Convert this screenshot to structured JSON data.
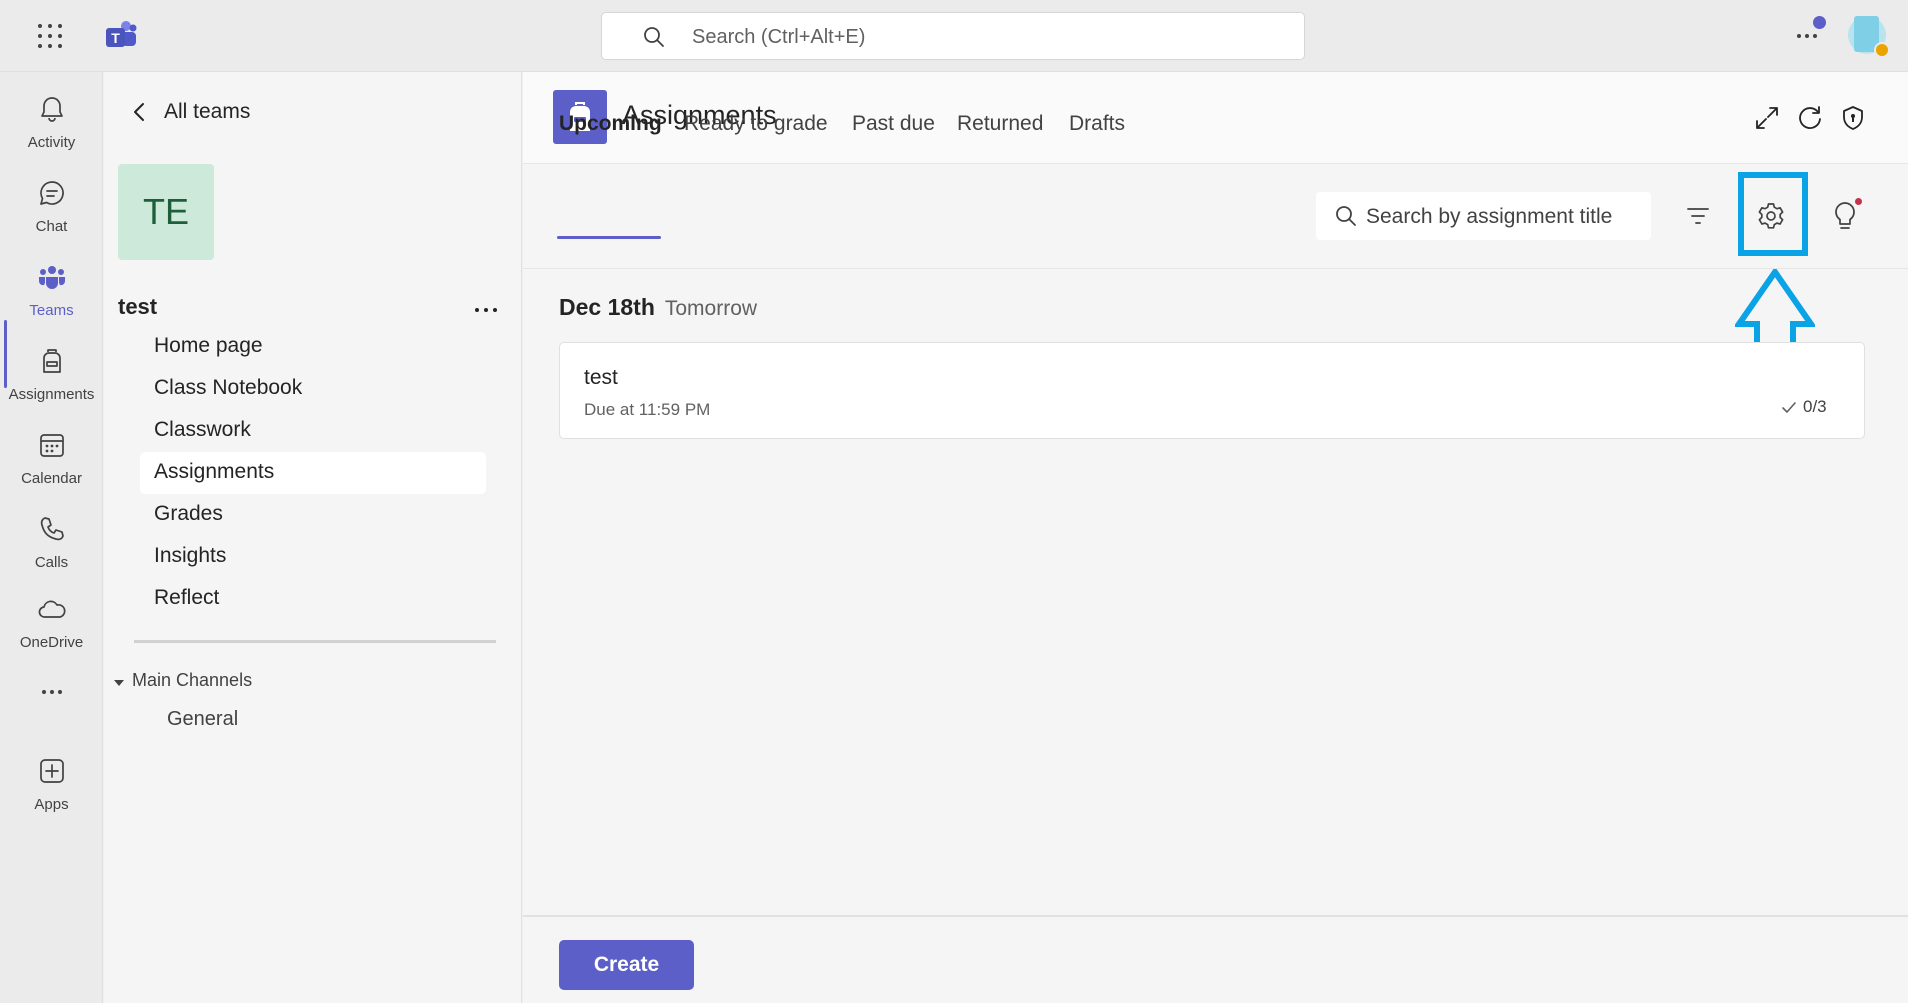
{
  "topbar": {
    "search_placeholder": "Search (Ctrl+Alt+E)",
    "icons": [
      "app-launcher-icon",
      "teams-logo-icon",
      "search-icon",
      "more-options-icon",
      "avatar"
    ]
  },
  "rail": {
    "items": [
      {
        "label": "Activity",
        "icon": "bell-icon"
      },
      {
        "label": "Chat",
        "icon": "chat-icon"
      },
      {
        "label": "Teams",
        "icon": "teams-icon",
        "active": true
      },
      {
        "label": "Assignments",
        "icon": "backpack-icon"
      },
      {
        "label": "Calendar",
        "icon": "calendar-icon"
      },
      {
        "label": "Calls",
        "icon": "phone-icon"
      },
      {
        "label": "OneDrive",
        "icon": "cloud-icon"
      },
      {
        "label": "Apps",
        "icon": "add-app-icon"
      }
    ]
  },
  "team": {
    "back_label": "All teams",
    "tile_initials": "TE",
    "name": "test",
    "nav": [
      {
        "label": "Home page"
      },
      {
        "label": "Class Notebook"
      },
      {
        "label": "Classwork"
      },
      {
        "label": "Assignments",
        "selected": true
      },
      {
        "label": "Grades"
      },
      {
        "label": "Insights"
      },
      {
        "label": "Reflect"
      }
    ],
    "channels_header": "Main Channels",
    "channels": [
      "General"
    ]
  },
  "app": {
    "title": "Assignments",
    "tabs": [
      "Upcoming",
      "Ready to grade",
      "Past due",
      "Returned",
      "Drafts"
    ],
    "active_tab": "Upcoming",
    "search_placeholder": "Search by assignment title"
  },
  "list": {
    "date": "Dec 18th",
    "relative": "Tomorrow",
    "assignments": [
      {
        "title": "test",
        "due": "Due at 11:59 PM",
        "progress": "0/3"
      }
    ]
  },
  "footer": {
    "create_label": "Create"
  },
  "colors": {
    "accent": "#5b5fc7",
    "highlight": "#0aa3e6"
  }
}
